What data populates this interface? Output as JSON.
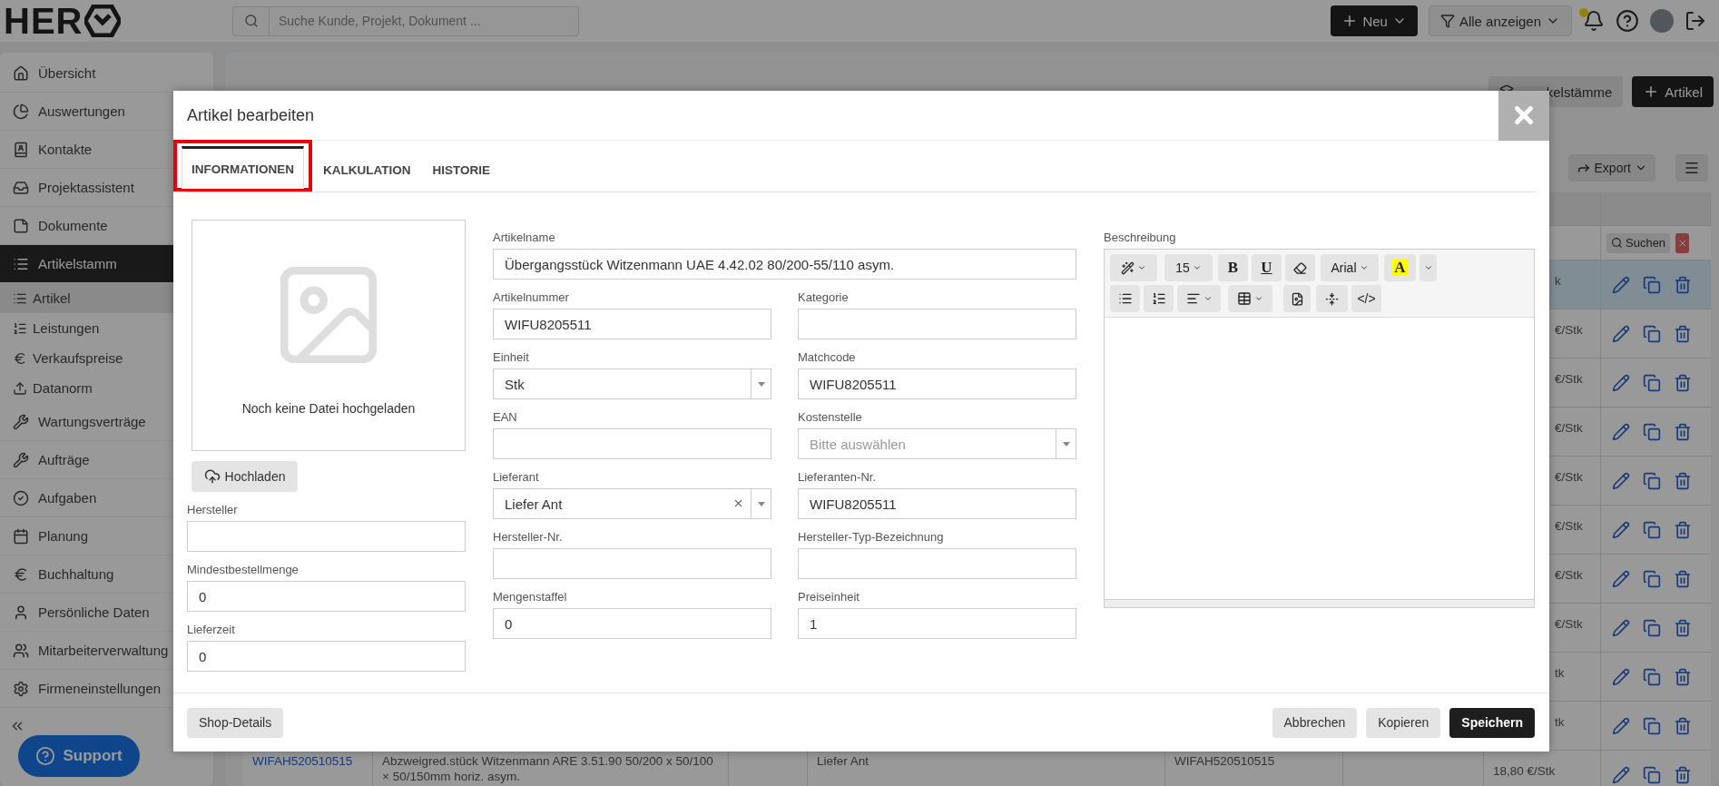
{
  "header": {
    "logo": "HER",
    "search": {
      "placeholder": "Suche Kunde, Projekt, Dokument ..."
    },
    "buttons": [
      {
        "kind": "new",
        "label": "Neu"
      },
      {
        "kind": "filter",
        "label": "Alle anzeigen"
      }
    ],
    "notifications": {
      "unread": true
    }
  },
  "sidebar": {
    "items": [
      {
        "label": "Übersicht",
        "selected": false
      },
      {
        "label": "Auswertungen",
        "selected": false
      },
      {
        "label": "Kontakte",
        "selected": false
      },
      {
        "label": "Projektassistent",
        "selected": false
      },
      {
        "label": "Dokumente",
        "selected": false
      },
      {
        "label": "Artikelstamm",
        "selected": true,
        "children": [
          {
            "label": "Artikel",
            "selected": true
          },
          {
            "label": "Leistungen",
            "selected": false
          },
          {
            "label": "Verkaufspreise",
            "selected": false
          },
          {
            "label": "Datanorm",
            "selected": false
          }
        ]
      },
      {
        "label": "Wartungsverträge",
        "selected": false
      },
      {
        "label": "Aufträge",
        "selected": false
      },
      {
        "label": "Aufgaben",
        "selected": false
      },
      {
        "label": "Planung",
        "selected": false
      },
      {
        "label": "Buchhaltung",
        "selected": false
      },
      {
        "label": "Persönliche Daten",
        "selected": false
      },
      {
        "label": "Mitarbeiterverwaltung",
        "selected": false
      },
      {
        "label": "Firmeneinstellungen",
        "selected": false
      }
    ],
    "support": "Support"
  },
  "page": {
    "buttons": [
      {
        "kind": "secondary",
        "label": "kelstämme"
      },
      {
        "kind": "primary",
        "label": "Artikel"
      }
    ],
    "export": "Export",
    "filter_search": "Suchen",
    "rows": [
      {
        "selected": true,
        "price": "k"
      },
      {
        "selected": false,
        "price": "€/Stk"
      },
      {
        "selected": false,
        "price": "€/Stk"
      },
      {
        "selected": false,
        "price": "€/Stk"
      },
      {
        "selected": false,
        "price": "€/Stk"
      },
      {
        "selected": false,
        "price": "€/Stk"
      },
      {
        "selected": false,
        "price": "€/Stk"
      },
      {
        "selected": false,
        "price": "€/Stk"
      },
      {
        "selected": false,
        "price": "tk"
      },
      {
        "selected": false,
        "price": "tk"
      },
      {
        "selected": false,
        "number": "WIFAH520510515",
        "name": "Abzweigred.stück Witzenmann ARE 3.51.90 50/200 x 50/100 × 50/150mm horiz. asym.",
        "supplier": "Liefer Ant",
        "supplier_number": "WIFAH520510515",
        "price": "18,80 €/Stk"
      }
    ]
  },
  "modal": {
    "title": "Artikel bearbeiten",
    "tabs": [
      {
        "label": "INFORMATIONEN",
        "selected": true,
        "highlighted": true
      },
      {
        "label": "KALKULATION",
        "selected": false,
        "highlighted": false
      },
      {
        "label": "HISTORIE",
        "selected": false,
        "highlighted": false
      }
    ],
    "upload": {
      "empty_text": "Noch keine Datei hochgeladen",
      "button": "Hochladen"
    },
    "left_fields": [
      {
        "label": "Hersteller"
      },
      {
        "label": "Mindestbestellmenge",
        "value": "0"
      },
      {
        "label": "Lieferzeit",
        "value": "0"
      }
    ],
    "name_field": {
      "label": "Artikelname",
      "value": "Übergangsstück Witzenmann UAE 4.42.02 80/200-55/110 asym."
    },
    "fields": [
      {
        "kind": "text",
        "label": "Artikelnummer",
        "value": "WIFU8205511"
      },
      {
        "kind": "text",
        "label": "Kategorie"
      },
      {
        "kind": "select",
        "label": "Einheit",
        "value": "Stk"
      },
      {
        "kind": "text",
        "label": "Matchcode",
        "value": "WIFU8205511"
      },
      {
        "kind": "text",
        "label": "EAN"
      },
      {
        "kind": "select",
        "label": "Kostenstelle",
        "placeholder": "Bitte auswählen"
      },
      {
        "kind": "select",
        "label": "Lieferant",
        "value": "Liefer Ant",
        "clearable": true
      },
      {
        "kind": "text",
        "label": "Lieferanten-Nr.",
        "value": "WIFU8205511"
      },
      {
        "kind": "text",
        "label": "Hersteller-Nr."
      },
      {
        "kind": "text",
        "label": "Hersteller-Typ-Bezeichnung"
      },
      {
        "kind": "text",
        "label": "Mengenstaffel",
        "value": "0"
      },
      {
        "kind": "text",
        "label": "Preiseinheit",
        "value": "1"
      }
    ],
    "editor": {
      "label": "Beschreibung",
      "font_size": "15",
      "bold": "B",
      "underline": "U",
      "font": "Arial",
      "color_letter": "A",
      "code": "</>"
    },
    "footer": {
      "left": "Shop-Details",
      "buttons": [
        {
          "kind": "secondary",
          "label": "Abbrechen"
        },
        {
          "kind": "secondary",
          "label": "Kopieren"
        },
        {
          "kind": "primary",
          "label": "Speichern"
        }
      ]
    }
  }
}
